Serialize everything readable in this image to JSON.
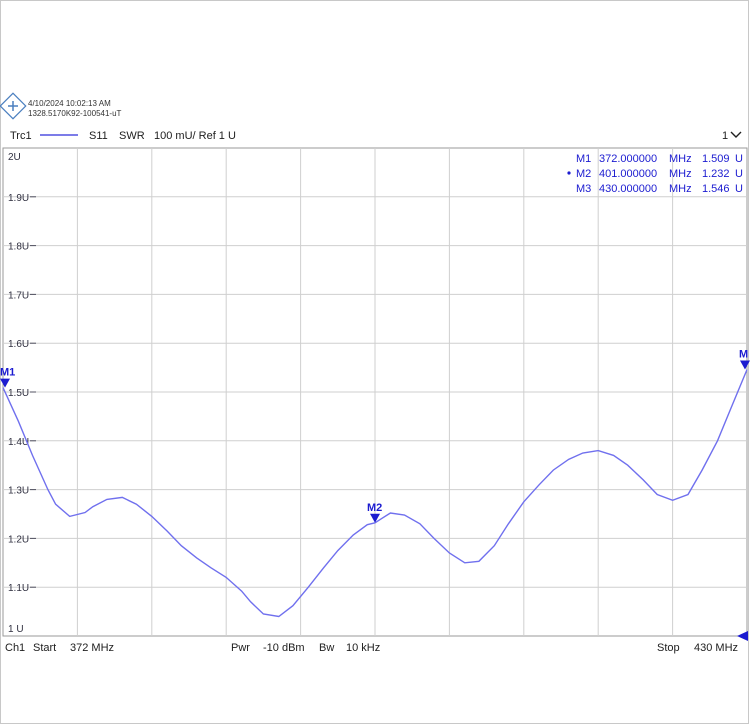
{
  "header": {
    "timestamp": "4/10/2024 10:02:13 AM",
    "instrument_id": "1328.5170K92-100541-uT"
  },
  "trace_bar": {
    "trace": "Trc1",
    "param": "S11",
    "format": "SWR",
    "scale": "100 mU/ Ref 1 U",
    "channel_selector": "1"
  },
  "footer": {
    "ch": "Ch1",
    "start_label": "Start",
    "start_value": "372 MHz",
    "pwr_label": "Pwr",
    "pwr_value": "-10 dBm",
    "bw_label": "Bw",
    "bw_value": "10 kHz",
    "stop_label": "Stop",
    "stop_value": "430 MHz"
  },
  "markers": [
    {
      "name": "M1",
      "active": false,
      "freq": "372.000000",
      "freq_unit": "MHz",
      "value": "1.509",
      "value_unit": "U"
    },
    {
      "name": "M2",
      "active": true,
      "freq": "401.000000",
      "freq_unit": "MHz",
      "value": "1.232",
      "value_unit": "U"
    },
    {
      "name": "M3",
      "active": false,
      "freq": "430.000000",
      "freq_unit": "MHz",
      "value": "1.546",
      "value_unit": "U"
    }
  ],
  "marker_tags": [
    "M1",
    "M2",
    "M"
  ],
  "colors": {
    "trace": "#7070ee",
    "marker": "#1b1bd0",
    "grid": "#cfcfcf"
  },
  "chart_data": {
    "type": "line",
    "x_unit": "MHz",
    "y_unit": "U",
    "xlim": [
      372,
      430
    ],
    "ylim": [
      1.0,
      2.0
    ],
    "ytick_labels": [
      "2U",
      "1.9U",
      "1.8U",
      "1.7U",
      "1.6U",
      "1.5U",
      "1.4U",
      "1.3U",
      "1.2U",
      "1.1U",
      "1 U"
    ],
    "yticks": [
      2.0,
      1.9,
      1.8,
      1.7,
      1.6,
      1.5,
      1.4,
      1.3,
      1.2,
      1.1,
      1.0
    ],
    "x_divisions": 10,
    "grid": true,
    "series": [
      {
        "x": [
          372,
          373.2,
          374.3,
          375.5,
          376.1,
          377.2,
          378.4,
          379.0,
          380.1,
          381.3,
          382.4,
          383.6,
          384.8,
          385.9,
          387.1,
          388.2,
          389.4,
          390.6,
          391.3,
          392.3,
          393.5,
          394.6,
          395.8,
          397.0,
          398.1,
          399.3,
          400.4,
          401.0,
          402.2,
          403.3,
          404.5,
          405.6,
          406.8,
          408.0,
          409.1,
          410.3,
          411.4,
          412.6,
          413.8,
          414.9,
          416.1,
          417.2,
          418.4,
          419.6,
          420.7,
          421.9,
          423.0,
          424.2,
          425.4,
          426.5,
          427.7,
          428.8,
          430.0
        ],
        "y": [
          1.509,
          1.44,
          1.37,
          1.3,
          1.27,
          1.245,
          1.253,
          1.265,
          1.28,
          1.284,
          1.27,
          1.245,
          1.215,
          1.185,
          1.16,
          1.14,
          1.12,
          1.092,
          1.07,
          1.045,
          1.04,
          1.062,
          1.1,
          1.14,
          1.175,
          1.207,
          1.228,
          1.232,
          1.252,
          1.248,
          1.23,
          1.2,
          1.17,
          1.15,
          1.153,
          1.185,
          1.23,
          1.275,
          1.31,
          1.34,
          1.362,
          1.375,
          1.38,
          1.37,
          1.35,
          1.32,
          1.29,
          1.278,
          1.29,
          1.34,
          1.4,
          1.47,
          1.546
        ]
      }
    ],
    "marker_points": [
      {
        "name": "M1",
        "x": 372,
        "y": 1.509
      },
      {
        "name": "M2",
        "x": 401,
        "y": 1.232
      },
      {
        "name": "M3",
        "x": 430,
        "y": 1.546
      }
    ]
  }
}
